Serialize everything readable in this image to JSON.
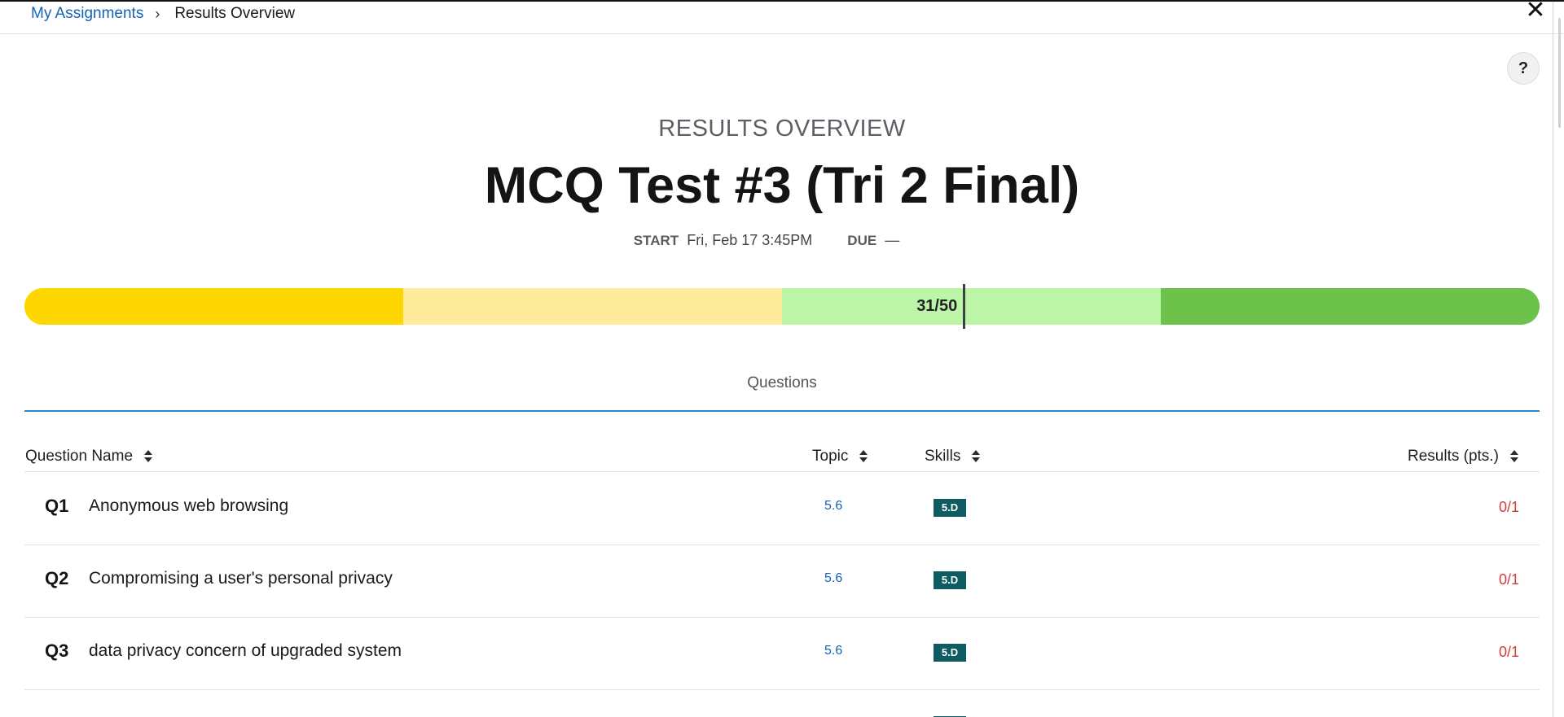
{
  "breadcrumb": {
    "link_label": "My Assignments",
    "separator": "›",
    "current": "Results Overview"
  },
  "close_label": "✕",
  "help_label": "?",
  "header": {
    "overline": "RESULTS OVERVIEW",
    "title": "MCQ Test #3 (Tri 2 Final)",
    "start_label": "START",
    "start_value": "Fri, Feb 17 3:45PM",
    "due_label": "DUE",
    "due_value": "—"
  },
  "score": {
    "label": "31/50",
    "earned": 31,
    "total": 50,
    "band_colors": [
      "#ffd700",
      "#ffeb9c",
      "#bdf5a8",
      "#6cc24a"
    ]
  },
  "tabs": {
    "questions": "Questions"
  },
  "table": {
    "columns": {
      "question_name": "Question Name",
      "topic": "Topic",
      "skills": "Skills",
      "results": "Results (pts.)"
    },
    "rows": [
      {
        "num": "Q1",
        "name": "Anonymous web browsing",
        "topic": "5.6",
        "skill": "5.D",
        "result": "0/1"
      },
      {
        "num": "Q2",
        "name": "Compromising a user's personal privacy",
        "topic": "5.6",
        "skill": "5.D",
        "result": "0/1"
      },
      {
        "num": "Q3",
        "name": "data privacy concern of upgraded system",
        "topic": "5.6",
        "skill": "5.D",
        "result": "0/1"
      }
    ]
  }
}
